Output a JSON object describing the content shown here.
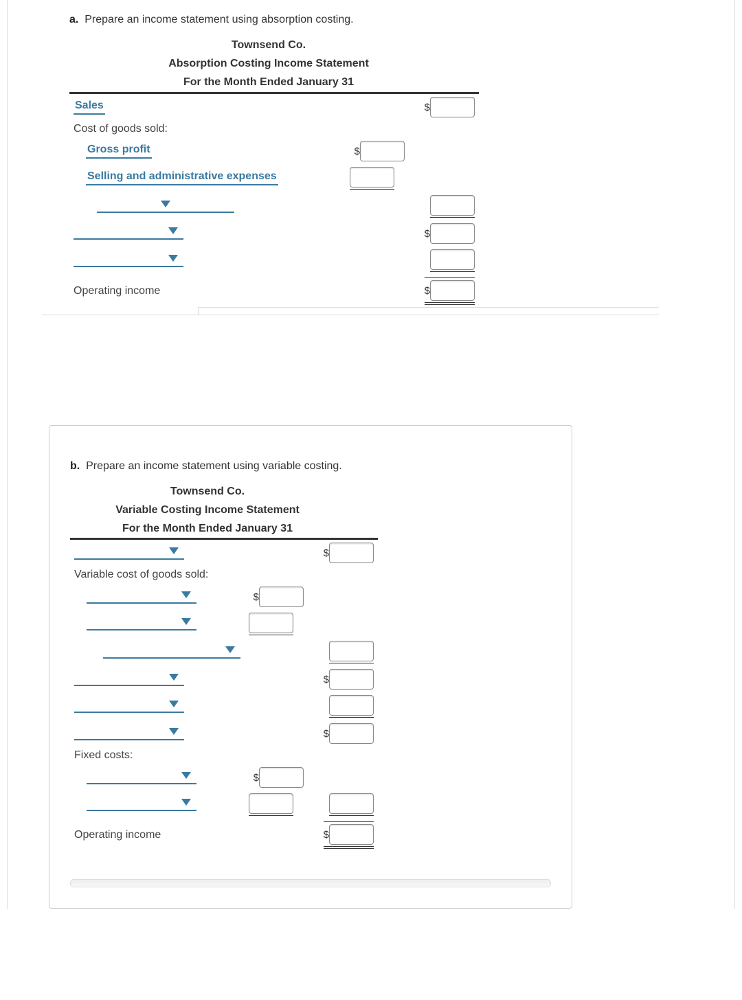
{
  "a": {
    "prompt_letter": "a.",
    "prompt": "Prepare an income statement using absorption costing.",
    "company": "Townsend Co.",
    "title": "Absorption Costing Income Statement",
    "period": "For the Month Ended January 31",
    "rows": {
      "sales": "Sales",
      "cogs": "Cost of goods sold:",
      "gross_profit": "Gross profit",
      "sell_admin": "Selling and administrative expenses",
      "op_income": "Operating income"
    },
    "dollar": "$"
  },
  "b": {
    "prompt_letter": "b.",
    "prompt": "Prepare an income statement using variable costing.",
    "company": "Townsend Co.",
    "title": "Variable Costing Income Statement",
    "period": "For the Month Ended January 31",
    "rows": {
      "var_cogs": "Variable cost of goods sold:",
      "fixed": "Fixed costs:",
      "op_income": "Operating income"
    },
    "dollar": "$"
  }
}
